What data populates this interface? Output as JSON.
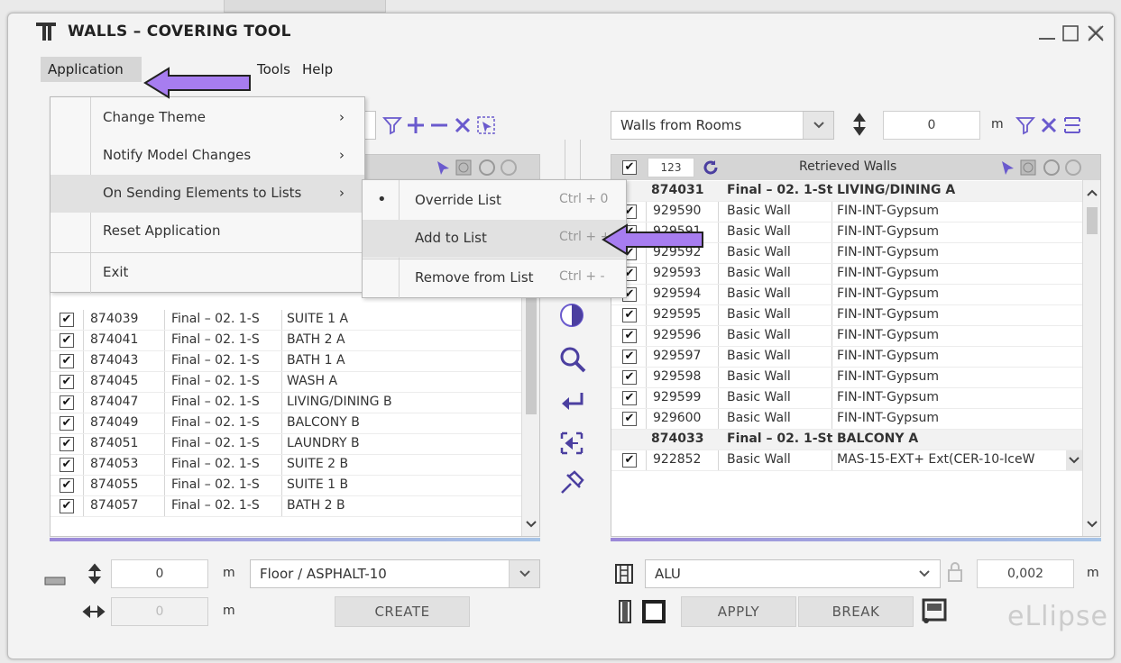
{
  "window": {
    "title": "WALLS – COVERING TOOL"
  },
  "menubar": {
    "items": [
      "Application",
      "Tools",
      "Help"
    ]
  },
  "app_menu": {
    "items": [
      {
        "label": "Change Theme",
        "arrow": "›"
      },
      {
        "label": "Notify Model Changes",
        "arrow": "›"
      },
      {
        "label": "On Sending Elements to Lists",
        "arrow": "›"
      },
      {
        "label": "Reset Application",
        "arrow": ""
      },
      {
        "label": "Exit",
        "arrow": ""
      }
    ]
  },
  "submenu": {
    "items": [
      {
        "label": "Override List",
        "shortcut": "Ctrl + 0",
        "selected": true
      },
      {
        "label": "Add to List",
        "shortcut": "Ctrl + +",
        "selected": false
      },
      {
        "label": "Remove from List",
        "shortcut": "Ctrl + -",
        "selected": false
      }
    ]
  },
  "left_panel": {
    "rows": [
      {
        "id": "874039",
        "level": "Final – 02. 1-S",
        "room": "SUITE 1 A"
      },
      {
        "id": "874041",
        "level": "Final – 02. 1-S",
        "room": "BATH 2 A"
      },
      {
        "id": "874043",
        "level": "Final – 02. 1-S",
        "room": "BATH 1 A"
      },
      {
        "id": "874045",
        "level": "Final – 02. 1-S",
        "room": "WASH A"
      },
      {
        "id": "874047",
        "level": "Final – 02. 1-S",
        "room": "LIVING/DINING B"
      },
      {
        "id": "874049",
        "level": "Final – 02. 1-S",
        "room": "BALCONY B"
      },
      {
        "id": "874051",
        "level": "Final – 02. 1-S",
        "room": "LAUNDRY B"
      },
      {
        "id": "874053",
        "level": "Final – 02. 1-S",
        "room": "SUITE 2 B"
      },
      {
        "id": "874055",
        "level": "Final – 02. 1-S",
        "room": "SUITE 1 B"
      },
      {
        "id": "874057",
        "level": "Final – 02. 1-S",
        "room": "BATH 2 B"
      }
    ],
    "offset_value": "0",
    "offset_unit": "m",
    "floor_type": "Floor / ASPHALT-10",
    "width_value": "0",
    "width_unit": "m",
    "create_label": "CREATE"
  },
  "right_panel": {
    "source": "Walls from Rooms",
    "offset_value": "0",
    "offset_unit": "m",
    "count": "123",
    "header_label": "Retrieved Walls",
    "groups": [
      {
        "id": "874031",
        "level": "Final – 02. 1-St",
        "room": "LIVING/DINING A",
        "rows": [
          {
            "id": "929590",
            "type": "Basic Wall",
            "finish": "FIN-INT-Gypsum"
          },
          {
            "id": "929591",
            "type": "Basic Wall",
            "finish": "FIN-INT-Gypsum"
          },
          {
            "id": "929592",
            "type": "Basic Wall",
            "finish": "FIN-INT-Gypsum"
          },
          {
            "id": "929593",
            "type": "Basic Wall",
            "finish": "FIN-INT-Gypsum"
          },
          {
            "id": "929594",
            "type": "Basic Wall",
            "finish": "FIN-INT-Gypsum"
          },
          {
            "id": "929595",
            "type": "Basic Wall",
            "finish": "FIN-INT-Gypsum"
          },
          {
            "id": "929596",
            "type": "Basic Wall",
            "finish": "FIN-INT-Gypsum"
          },
          {
            "id": "929597",
            "type": "Basic Wall",
            "finish": "FIN-INT-Gypsum"
          },
          {
            "id": "929598",
            "type": "Basic Wall",
            "finish": "FIN-INT-Gypsum"
          },
          {
            "id": "929599",
            "type": "Basic Wall",
            "finish": "FIN-INT-Gypsum"
          },
          {
            "id": "929600",
            "type": "Basic Wall",
            "finish": "FIN-INT-Gypsum"
          }
        ]
      },
      {
        "id": "874033",
        "level": "Final – 02. 1-St",
        "room": "BALCONY A",
        "rows": [
          {
            "id": "922852",
            "type": "Basic Wall",
            "finish": "MAS-15-EXT+ Ext(CER-10-IceW"
          }
        ]
      }
    ],
    "material": "ALU",
    "thickness": "0,002",
    "thickness_unit": "m",
    "apply_label": "APPLY",
    "break_label": "BREAK"
  },
  "footer": {
    "logo": "eLlipse"
  },
  "colors": {
    "accent": "#9b6ee8",
    "annotation_arrow": "#a77df0"
  }
}
